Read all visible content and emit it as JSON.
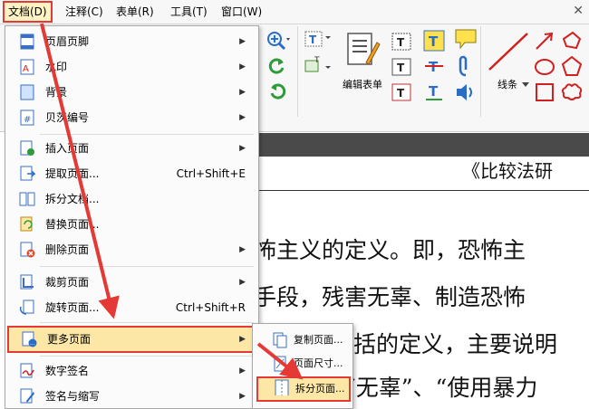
{
  "menubar": {
    "items": [
      {
        "label": "文档(D)"
      },
      {
        "label": "注释(C)"
      },
      {
        "label": "表单(R)"
      },
      {
        "label": "工具(T)"
      },
      {
        "label": "窗口(W)"
      }
    ],
    "close_glyph": "✕"
  },
  "ribbon": {
    "edit_form_label": "编辑表单",
    "lines_label": "线条"
  },
  "document": {
    "lines": [
      "《比较法研",
      "怖主义的定义。即，恐怖主",
      "手段，残害无辜、制造恐怖",
      "括的定义，主要说明",
      "“无辜”、“使用暴力"
    ]
  },
  "document_menu": {
    "items": [
      {
        "label": "页眉页脚",
        "icon": "header-footer-icon",
        "submenu": true
      },
      {
        "label": "水印",
        "icon": "watermark-icon",
        "submenu": true
      },
      {
        "label": "背景",
        "icon": "background-icon",
        "submenu": true
      },
      {
        "label": "贝茨编号",
        "icon": "bates-number-icon",
        "submenu": true
      },
      {
        "label": "插入页面",
        "icon": "insert-page-icon",
        "submenu": true
      },
      {
        "label": "提取页面...",
        "icon": "extract-page-icon",
        "shortcut": "Ctrl+Shift+E"
      },
      {
        "label": "拆分文档...",
        "icon": "split-document-icon"
      },
      {
        "label": "替换页面...",
        "icon": "replace-page-icon"
      },
      {
        "label": "删除页面",
        "icon": "delete-page-icon",
        "submenu": true
      },
      {
        "label": "裁剪页面",
        "icon": "crop-page-icon",
        "submenu": true
      },
      {
        "label": "旋转页面...",
        "icon": "rotate-page-icon",
        "shortcut": "Ctrl+Shift+R"
      },
      {
        "label": "更多页面",
        "icon": "more-pages-icon",
        "submenu": true,
        "highlighted": true
      },
      {
        "label": "数字签名",
        "icon": "digital-signature-icon",
        "submenu": true
      },
      {
        "label": "签名与缩写",
        "icon": "sign-initials-icon",
        "submenu": true
      }
    ]
  },
  "more_pages_submenu": {
    "items": [
      {
        "label": "复制页面...",
        "icon": "copy-page-icon"
      },
      {
        "label": "页面尺寸...",
        "icon": "page-size-icon"
      },
      {
        "label": "拆分页面...",
        "icon": "split-page-icon",
        "highlighted": true
      }
    ]
  },
  "colors": {
    "highlight_border": "#e53935",
    "highlight_fill": "#fde7a6",
    "arrow": "#e53935"
  }
}
